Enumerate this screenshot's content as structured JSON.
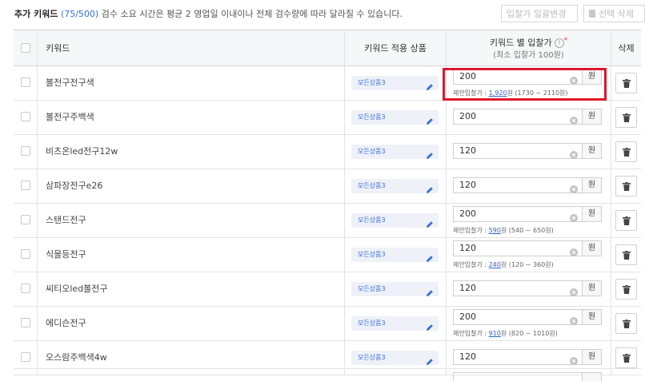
{
  "header": {
    "title": "추가 키워드",
    "count": "(75/500)",
    "description": "검수 소요 시간은 평균 2 영업일 이내이나 전체 검수량에 따라 달라질 수 있습니다.",
    "bulk_change_label": "입찰가 일괄변경",
    "delete_selected_label": "선택 삭제"
  },
  "table": {
    "col_keyword": "키워드",
    "col_product": "키워드 적용 상품",
    "col_bid": "키워드 별 입찰가",
    "col_bid_sub": "(최소 입찰가 100원)",
    "col_delete": "삭제",
    "unit": "원",
    "suggest_prefix": "제안입찰가 :",
    "rows": [
      {
        "keyword": "볼전구전구색",
        "product": "모든상품3",
        "bid": "200",
        "suggest_value": "1,920",
        "suggest_unit": "원",
        "suggest_range": "(1730 ~ 2110원)"
      },
      {
        "keyword": "볼전구주백색",
        "product": "모든상품3",
        "bid": "200"
      },
      {
        "keyword": "비츠온led전구12w",
        "product": "모든상품3",
        "bid": "120"
      },
      {
        "keyword": "삼파장전구e26",
        "product": "모든상품3",
        "bid": "120"
      },
      {
        "keyword": "스탠드전구",
        "product": "모든상품3",
        "bid": "200",
        "suggest_value": "590",
        "suggest_unit": "원",
        "suggest_range": "(540 ~ 650원)"
      },
      {
        "keyword": "식물등전구",
        "product": "모든상품3",
        "bid": "120",
        "suggest_value": "240",
        "suggest_unit": "원",
        "suggest_range": "(120 ~ 360원)"
      },
      {
        "keyword": "씨티오led볼전구",
        "product": "모든상품3",
        "bid": "120"
      },
      {
        "keyword": "에디슨전구",
        "product": "모든상품3",
        "bid": "200",
        "suggest_value": "910",
        "suggest_unit": "원",
        "suggest_range": "(820 ~ 1010원)"
      },
      {
        "keyword": "오스람주백색4w",
        "product": "모든상품3",
        "bid": "120"
      }
    ]
  },
  "colors": {
    "accent": "#3a6fd8",
    "highlight": "#e0152b",
    "product_tag_bg": "#eef1f7",
    "header_bg": "#f6f7f9"
  },
  "icons": {
    "edit": "pencil-icon",
    "clear": "clear-circle-icon",
    "delete": "trash-icon",
    "help": "question-circle-icon"
  }
}
